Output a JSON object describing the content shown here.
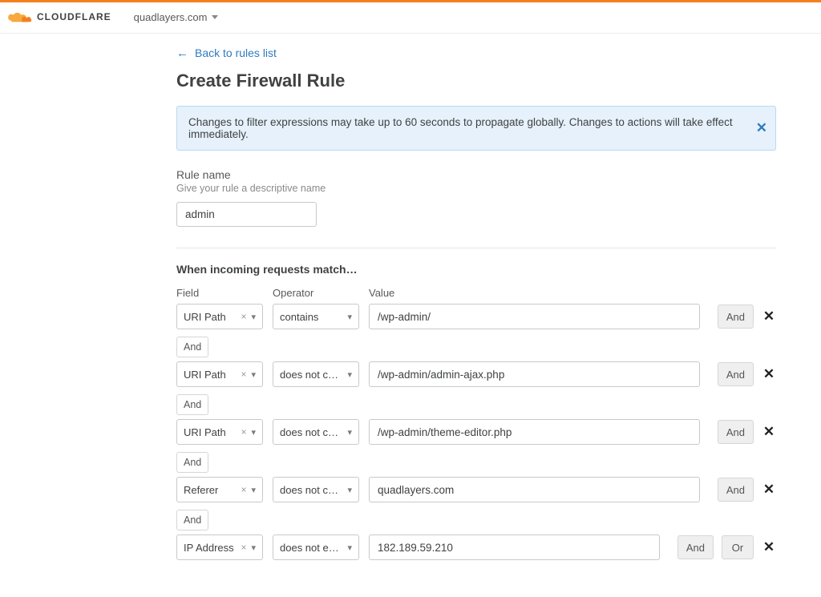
{
  "brand": {
    "name": "CLOUDFLARE"
  },
  "domain_selector": {
    "domain": "quadlayers.com"
  },
  "backlink": {
    "label": "Back to rules list"
  },
  "page_title": "Create Firewall Rule",
  "notice": {
    "text": "Changes to filter expressions may take up to 60 seconds to propagate globally. Changes to actions will take effect immediately."
  },
  "rule_name": {
    "label": "Rule name",
    "help": "Give your rule a descriptive name",
    "value": "admin"
  },
  "match_section": {
    "title": "When incoming requests match…",
    "columns": {
      "field": "Field",
      "operator": "Operator",
      "value": "Value"
    }
  },
  "logic_labels": {
    "and": "And",
    "or": "Or"
  },
  "rules": [
    {
      "field": "URI Path",
      "operator": "contains",
      "value": "/wp-admin/",
      "show_and": true,
      "show_or": false,
      "connector_after": "And"
    },
    {
      "field": "URI Path",
      "operator": "does not cont...",
      "value": "/wp-admin/admin-ajax.php",
      "show_and": true,
      "show_or": false,
      "connector_after": "And"
    },
    {
      "field": "URI Path",
      "operator": "does not cont...",
      "value": "/wp-admin/theme-editor.php",
      "show_and": true,
      "show_or": false,
      "connector_after": "And"
    },
    {
      "field": "Referer",
      "operator": "does not cont...",
      "value": "quadlayers.com",
      "show_and": true,
      "show_or": false,
      "connector_after": "And"
    },
    {
      "field": "IP Address",
      "operator": "does not equal",
      "value": "182.189.59.210",
      "show_and": true,
      "show_or": true,
      "connector_after": null
    }
  ]
}
